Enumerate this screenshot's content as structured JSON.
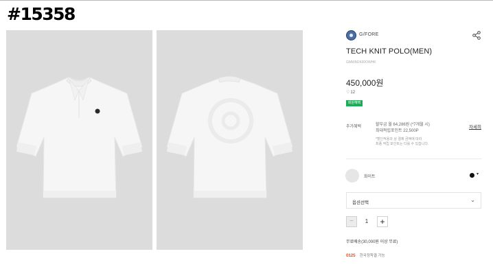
{
  "tag_id": "#15358",
  "brand": {
    "name": "G/FORE",
    "icon": "brand-logo"
  },
  "product": {
    "title": "TECH KNIT POLO(MEN)",
    "code": "GMWM2430OWHK",
    "price": "450,000원",
    "likes": "12",
    "badge": "회원혜택"
  },
  "benefit": {
    "label": "추가혜택",
    "installment": "할부금 월 64,286원 (*7개월 시)",
    "points": "최대적립포인트 22,500P",
    "note_line1": "*할인적용과 상 결제 금액에 따라",
    "note_line2": "최종 적립 포인트는 다를 수 있습니다.",
    "detail_link": "자세히"
  },
  "color_option": {
    "name": "화이트",
    "selected_dot_color": "#111111"
  },
  "option_select": {
    "label": "옵션선택"
  },
  "quantity": {
    "value": "1",
    "minus": "−",
    "plus": "+"
  },
  "shipping": {
    "text": "무료배송(30,000원 이상 무료)",
    "pay_logo": "0125",
    "pay_text": "한국정착결 가능"
  },
  "colors": {
    "photo_bg": "#dcdcdc",
    "badge_green": "#1faa59",
    "shirt": "#f6f6f6"
  }
}
